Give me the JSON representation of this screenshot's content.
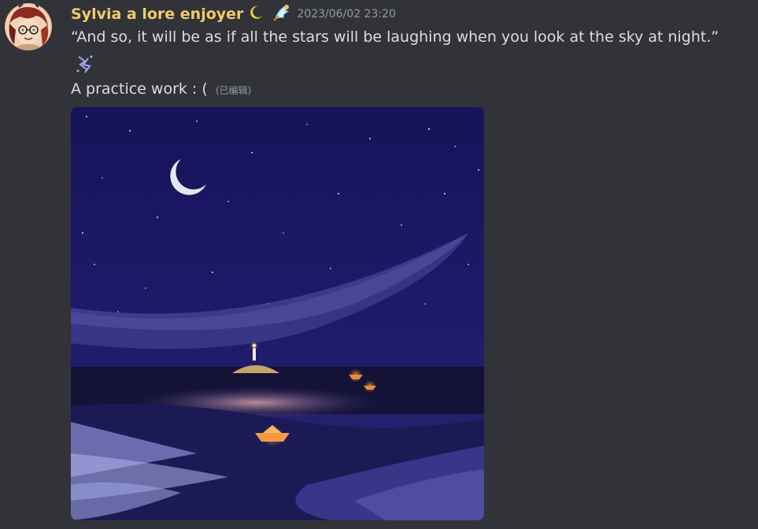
{
  "message": {
    "author": {
      "name": "Sylvia a lore enjoyer",
      "name_color": "#f0cc6a",
      "emoji": "crescent-moon-icon",
      "badge": "winged-badge-icon",
      "avatar": "avatar"
    },
    "timestamp": "2023/06/02 23:20",
    "content_line1": "“And so, it will be as if all the stars will be laughing when you look at the sky at night.”",
    "content_emoji": "sparkles-icon",
    "content_line3": "A practice work : (",
    "edited_label": "(已编辑)",
    "attachment": {
      "type": "image",
      "subject": "night-sky-painting"
    }
  }
}
